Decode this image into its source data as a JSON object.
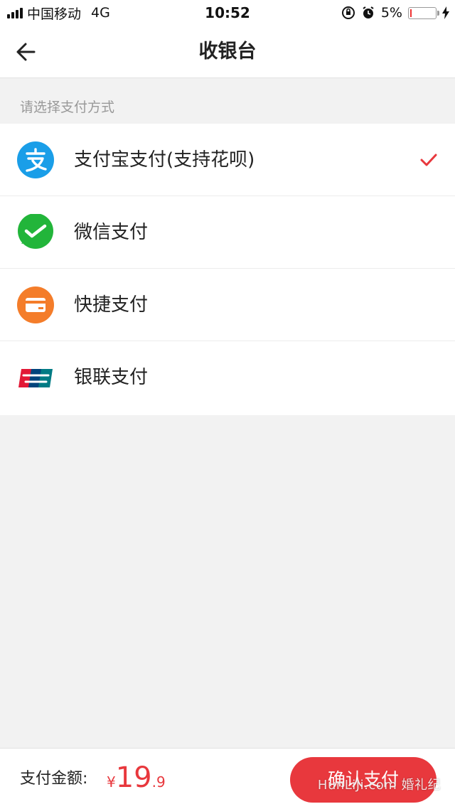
{
  "status_bar": {
    "carrier": "中国移动",
    "network": "4G",
    "time": "10:52",
    "battery_text": "5%",
    "battery_level": 0.05
  },
  "nav": {
    "title": "收银台",
    "back_icon": "arrow-left-icon"
  },
  "section_label": "请选择支付方式",
  "methods": [
    {
      "label": "支付宝支付(支持花呗)",
      "icon": "alipay-icon",
      "selected": true
    },
    {
      "label": "微信支付",
      "icon": "wechat-pay-icon",
      "selected": false
    },
    {
      "label": "快捷支付",
      "icon": "card-icon",
      "selected": false
    },
    {
      "label": "银联支付",
      "icon": "unionpay-icon",
      "selected": false
    }
  ],
  "footer": {
    "amount_label": "支付金额:",
    "currency": "¥",
    "amount_int": "19",
    "amount_dec": ".9",
    "confirm_label": "确认支付"
  },
  "watermark": "HunLiJi.com 婚礼纪",
  "colors": {
    "accent": "#e8383d",
    "alipay": "#1a9ee8",
    "wechat": "#22b53a",
    "quickpay": "#f47d2a"
  }
}
